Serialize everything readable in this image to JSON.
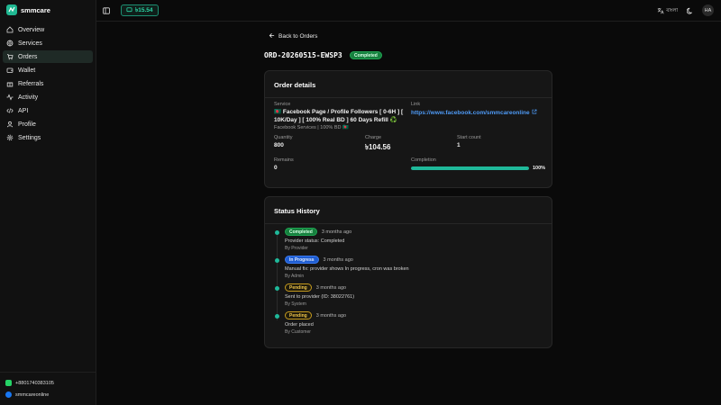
{
  "app": {
    "brand": "smmcare"
  },
  "sidebar": {
    "items": [
      {
        "label": "Overview",
        "icon": "home-icon"
      },
      {
        "label": "Services",
        "icon": "globe-icon"
      },
      {
        "label": "Orders",
        "icon": "cart-icon",
        "active": true
      },
      {
        "label": "Wallet",
        "icon": "wallet-icon"
      },
      {
        "label": "Referrals",
        "icon": "gift-icon"
      },
      {
        "label": "Activity",
        "icon": "activity-icon"
      },
      {
        "label": "API",
        "icon": "code-icon"
      },
      {
        "label": "Profile",
        "icon": "user-icon"
      },
      {
        "label": "Settings",
        "icon": "gear-icon"
      }
    ],
    "footer": {
      "whatsapp": "+8801740383105",
      "facebook": "smmcareonline"
    }
  },
  "topbar": {
    "balance": "৳15.54",
    "language": "বাংলা",
    "avatar": "HA"
  },
  "page": {
    "back_label": "Back to Orders",
    "order_id": "ORD-20260515-EWSP3",
    "status": "Completed"
  },
  "order_details": {
    "title": "Order details",
    "service_label": "Service",
    "service_name": "🇧🇩 Facebook Page / Profile Followers [ 0-6H ] [ 10K/Day ] [ 100% Real BD ] 60 Days Refill ♻️",
    "service_category": "Facebook Services | 100% BD 🇧🇩",
    "link_label": "Link",
    "link_value": "https://www.facebook.com/smmcareonline",
    "quantity_label": "Quantity",
    "quantity": "800",
    "charge_label": "Charge",
    "charge": "৳104.56",
    "start_count_label": "Start count",
    "start_count": "1",
    "remains_label": "Remains",
    "remains": "0",
    "completion_label": "Completion",
    "completion_pct": 100,
    "completion_text": "100%"
  },
  "status_history": {
    "title": "Status History",
    "entries": [
      {
        "status": "Completed",
        "kind": "completed",
        "time": "3 months ago",
        "note": "Provider status: Completed",
        "by": "By Provider"
      },
      {
        "status": "In Progress",
        "kind": "progress",
        "time": "3 months ago",
        "note": "Manual fix: provider shows In progress, cron was broken",
        "by": "By Admin"
      },
      {
        "status": "Pending",
        "kind": "pending",
        "time": "3 months ago",
        "note": "Sent to provider (ID: 38022761)",
        "by": "By System"
      },
      {
        "status": "Pending",
        "kind": "pending",
        "time": "3 months ago",
        "note": "Order placed",
        "by": "By Customer"
      }
    ]
  },
  "colors": {
    "accent": "#1fb99a",
    "link": "#4e9af5",
    "completed": "#16803e",
    "in_progress": "#1f5dd1",
    "pending": "#c59a1e"
  }
}
